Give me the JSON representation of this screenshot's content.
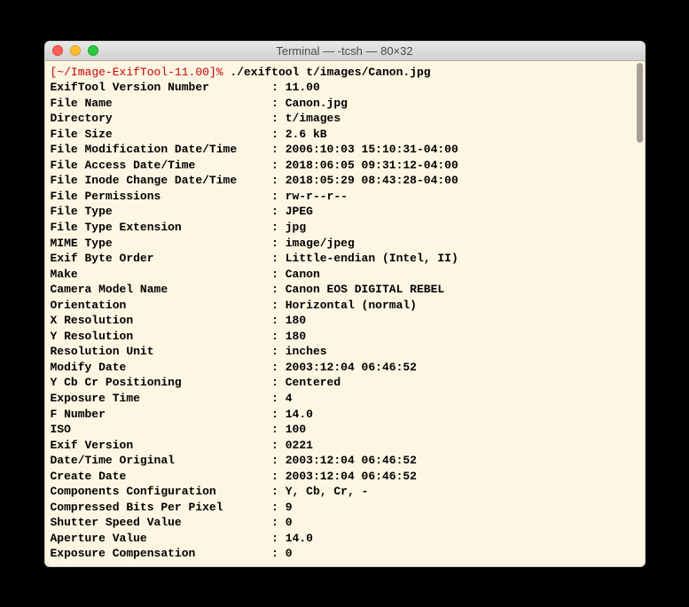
{
  "window": {
    "title": "Terminal — -tcsh — 80×32"
  },
  "prompt": {
    "open": "[",
    "path": "~/Image-ExifTool-11.00",
    "close": "]%",
    "command": "./exiftool t/images/Canon.jpg"
  },
  "rows": [
    {
      "label": "ExifTool Version Number",
      "value": "11.00"
    },
    {
      "label": "File Name",
      "value": "Canon.jpg"
    },
    {
      "label": "Directory",
      "value": "t/images"
    },
    {
      "label": "File Size",
      "value": "2.6 kB"
    },
    {
      "label": "File Modification Date/Time",
      "value": "2006:10:03 15:10:31-04:00"
    },
    {
      "label": "File Access Date/Time",
      "value": "2018:06:05 09:31:12-04:00"
    },
    {
      "label": "File Inode Change Date/Time",
      "value": "2018:05:29 08:43:28-04:00"
    },
    {
      "label": "File Permissions",
      "value": "rw-r--r--"
    },
    {
      "label": "File Type",
      "value": "JPEG"
    },
    {
      "label": "File Type Extension",
      "value": "jpg"
    },
    {
      "label": "MIME Type",
      "value": "image/jpeg"
    },
    {
      "label": "Exif Byte Order",
      "value": "Little-endian (Intel, II)"
    },
    {
      "label": "Make",
      "value": "Canon"
    },
    {
      "label": "Camera Model Name",
      "value": "Canon EOS DIGITAL REBEL"
    },
    {
      "label": "Orientation",
      "value": "Horizontal (normal)"
    },
    {
      "label": "X Resolution",
      "value": "180"
    },
    {
      "label": "Y Resolution",
      "value": "180"
    },
    {
      "label": "Resolution Unit",
      "value": "inches"
    },
    {
      "label": "Modify Date",
      "value": "2003:12:04 06:46:52"
    },
    {
      "label": "Y Cb Cr Positioning",
      "value": "Centered"
    },
    {
      "label": "Exposure Time",
      "value": "4"
    },
    {
      "label": "F Number",
      "value": "14.0"
    },
    {
      "label": "ISO",
      "value": "100"
    },
    {
      "label": "Exif Version",
      "value": "0221"
    },
    {
      "label": "Date/Time Original",
      "value": "2003:12:04 06:46:52"
    },
    {
      "label": "Create Date",
      "value": "2003:12:04 06:46:52"
    },
    {
      "label": "Components Configuration",
      "value": "Y, Cb, Cr, -"
    },
    {
      "label": "Compressed Bits Per Pixel",
      "value": "9"
    },
    {
      "label": "Shutter Speed Value",
      "value": "0"
    },
    {
      "label": "Aperture Value",
      "value": "14.0"
    },
    {
      "label": "Exposure Compensation",
      "value": "0"
    }
  ],
  "layout": {
    "label_width": 32
  }
}
